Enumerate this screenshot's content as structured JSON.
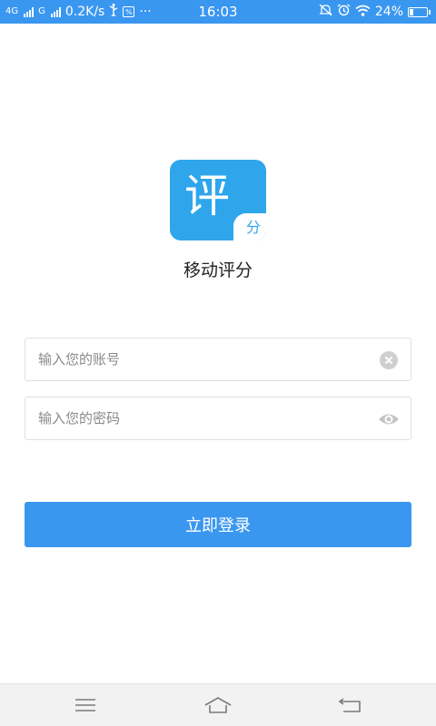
{
  "status_bar": {
    "network_1": "4G",
    "network_2": "G",
    "speed": "0.2K/s",
    "more": "···",
    "time": "16:03",
    "battery": "24%",
    "battery_level": 0.24,
    "box_icon_label": "%"
  },
  "logo": {
    "main_char": "评",
    "sub_char": "分"
  },
  "app_name": "移动评分",
  "account_field": {
    "placeholder": "输入您的账号",
    "value": ""
  },
  "password_field": {
    "placeholder": "输入您的密码",
    "value": ""
  },
  "login_button": {
    "label": "立即登录"
  },
  "icons": {
    "clear": "clear-icon",
    "eye": "eye-icon",
    "menu": "menu-icon",
    "home": "home-icon",
    "back": "back-icon"
  },
  "colors": {
    "status_bar": "#3a97f0",
    "accent": "#3a97f0",
    "logo": "#2fa6ec"
  }
}
